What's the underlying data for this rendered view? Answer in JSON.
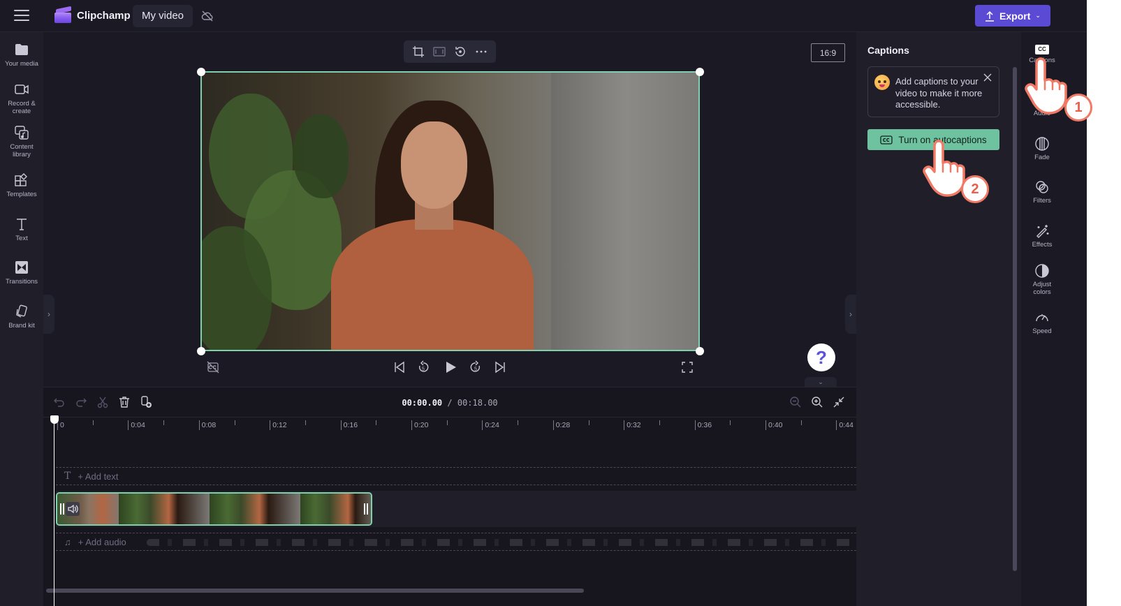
{
  "topbar": {
    "menu_icon": "hamburger-menu-icon",
    "brand_name": "Clipchamp",
    "project_title": "My video",
    "cloud_status_icon": "cloud-off-icon",
    "export_label": "Export",
    "export_icon": "upload-icon",
    "accent_color": "#5b4ad4"
  },
  "left_sidebar": {
    "items": [
      {
        "label_line1": "Your media",
        "label_line2": "",
        "icon": "folder-icon"
      },
      {
        "label_line1": "Record &",
        "label_line2": "create",
        "icon": "camera-icon"
      },
      {
        "label_line1": "Content",
        "label_line2": "library",
        "icon": "content-library-icon"
      },
      {
        "label_line1": "Templates",
        "label_line2": "",
        "icon": "templates-icon"
      },
      {
        "label_line1": "Text",
        "label_line2": "",
        "icon": "text-icon"
      },
      {
        "label_line1": "Transitions",
        "label_line2": "",
        "icon": "transitions-icon"
      },
      {
        "label_line1": "Brand kit",
        "label_line2": "",
        "icon": "brand-kit-icon"
      }
    ]
  },
  "preview": {
    "toolbar": [
      "crop-icon",
      "fit-icon",
      "rotate-icon",
      "more-icon"
    ],
    "aspect_ratio": "16:9",
    "selection_color": "#7fd1ae",
    "playback": {
      "captions_toggle": "captions-off-icon",
      "skip_back_seconds": "5",
      "skip_forward_seconds": "5"
    },
    "help_label": "?"
  },
  "timeline": {
    "current_time": "00:00.00",
    "separator": "/",
    "total_time": "00:18.00",
    "ruler_labels": [
      "0",
      "0:04",
      "0:08",
      "0:12",
      "0:16",
      "0:20",
      "0:24",
      "0:28",
      "0:32",
      "0:36",
      "0:40",
      "0:44"
    ],
    "add_text_label": "+ Add text",
    "add_audio_label": "+ Add audio"
  },
  "captions_panel": {
    "title": "Captions",
    "info_text": "Add captions to your video to make it more accessible.",
    "button_label": "Turn on autocaptions",
    "button_color": "#6fc2a0"
  },
  "right_tools": {
    "items": [
      {
        "label_line1": "Captions",
        "label_line2": "",
        "icon": "captions-icon",
        "badge": "CC"
      },
      {
        "label_line1": "Audio",
        "label_line2": "",
        "icon": "audio-icon"
      },
      {
        "label_line1": "Fade",
        "label_line2": "",
        "icon": "fade-icon"
      },
      {
        "label_line1": "Filters",
        "label_line2": "",
        "icon": "filters-icon"
      },
      {
        "label_line1": "Effects",
        "label_line2": "",
        "icon": "effects-icon"
      },
      {
        "label_line1": "Adjust",
        "label_line2": "colors",
        "icon": "adjust-colors-icon"
      },
      {
        "label_line1": "Speed",
        "label_line2": "",
        "icon": "speed-icon"
      }
    ]
  },
  "annotations": {
    "step1": "1",
    "step2": "2",
    "color": "#f07a66"
  }
}
